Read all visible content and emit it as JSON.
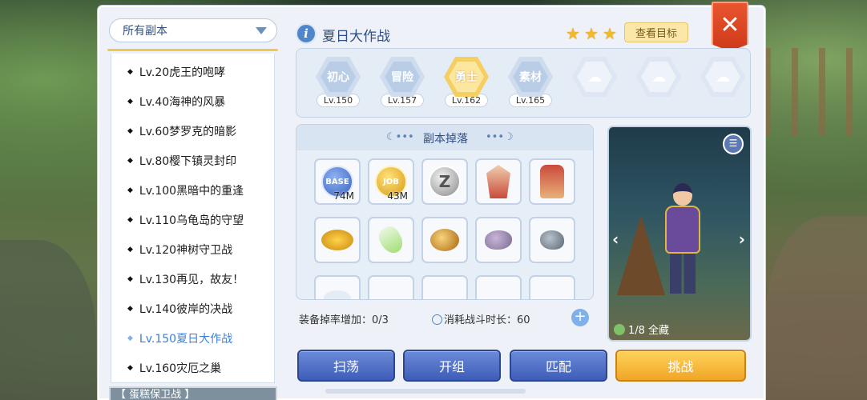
{
  "left_panel": {
    "dropdown_label": "所有副本",
    "items": [
      {
        "label": "Lv.20虎王的咆哮",
        "selected": false
      },
      {
        "label": "Lv.40海神的风暴",
        "selected": false
      },
      {
        "label": "Lv.60梦罗克的暗影",
        "selected": false
      },
      {
        "label": "Lv.80樱下镇灵封印",
        "selected": false
      },
      {
        "label": "Lv.100黑暗中的重逢",
        "selected": false
      },
      {
        "label": "Lv.110乌龟岛的守望",
        "selected": false
      },
      {
        "label": "Lv.120神树守卫战",
        "selected": false
      },
      {
        "label": "Lv.130再见，故友！",
        "selected": false
      },
      {
        "label": "Lv.140彼岸的决战",
        "selected": false
      },
      {
        "label": "Lv.150夏日大作战",
        "selected": true
      },
      {
        "label": "Lv.160灾厄之巢",
        "selected": false
      }
    ],
    "banner": "【 蛋糕保卫战 】"
  },
  "header": {
    "info_icon": "i",
    "title": "夏日大作战",
    "stars": 3,
    "goal_button": "查看目标",
    "close_icon": "✕"
  },
  "difficulties": [
    {
      "name": "初心",
      "level": "Lv.150",
      "state": "normal"
    },
    {
      "name": "冒险",
      "level": "Lv.157",
      "state": "normal"
    },
    {
      "name": "勇士",
      "level": "Lv.162",
      "state": "active"
    },
    {
      "name": "素材",
      "level": "Lv.165",
      "state": "normal"
    },
    {
      "name": "",
      "level": "",
      "state": "locked"
    },
    {
      "name": "",
      "level": "",
      "state": "locked"
    },
    {
      "name": "",
      "level": "",
      "state": "locked"
    }
  ],
  "drops": {
    "title": "副本掉落",
    "items": [
      {
        "icon": "base-exp-coin",
        "label": "BASE",
        "qty": "74M"
      },
      {
        "icon": "job-exp-coin",
        "label": "JOB",
        "qty": "43M"
      },
      {
        "icon": "zeny-coin",
        "label": "Z",
        "qty": ""
      },
      {
        "icon": "red-cloak-icon",
        "label": "",
        "qty": ""
      },
      {
        "icon": "red-garment-icon",
        "label": "",
        "qty": ""
      },
      {
        "icon": "gold-pile-icon",
        "label": "",
        "qty": ""
      },
      {
        "icon": "potion-bottle-icon",
        "label": "",
        "qty": ""
      },
      {
        "icon": "amber-stone-icon",
        "label": "",
        "qty": ""
      },
      {
        "icon": "purple-ore-icon",
        "label": "",
        "qty": ""
      },
      {
        "icon": "grey-ore-icon",
        "label": "",
        "qty": ""
      }
    ]
  },
  "stats": {
    "drop_rate": "装备掉率增加：0/3",
    "battle_time": "消耗战斗时长：60"
  },
  "character": {
    "collection": "1/8 全藏"
  },
  "buttons": {
    "sweep": "扫荡",
    "group": "开组",
    "match": "匹配",
    "challenge": "挑战"
  },
  "colors": {
    "accent_blue": "#3e5db8",
    "accent_orange": "#f0a526",
    "selected_text": "#3d7fd6",
    "close_red": "#cf3a19"
  }
}
